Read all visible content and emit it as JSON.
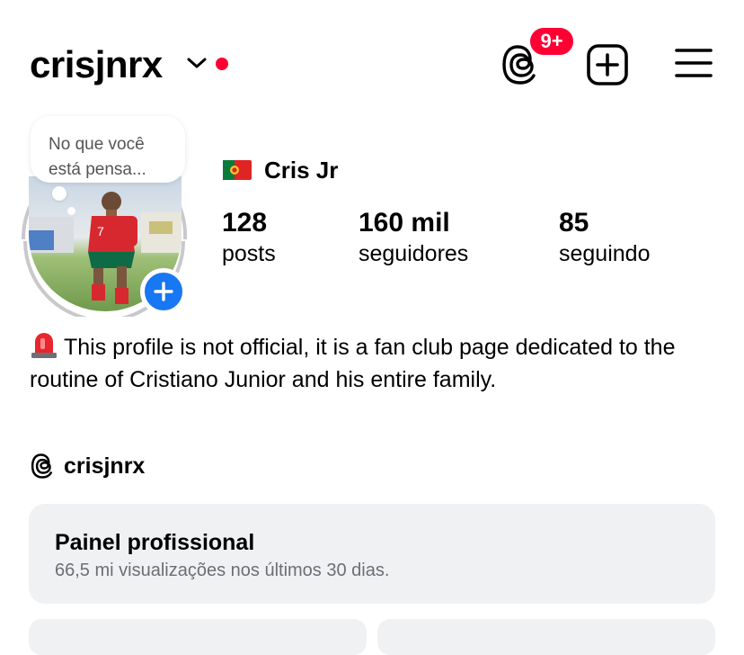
{
  "header": {
    "username": "crisjnrx",
    "notification_badge": "9+"
  },
  "note": {
    "text": "No que você está pensa..."
  },
  "profile": {
    "display_name": "Cris Jr",
    "stats": [
      {
        "value": "128",
        "label": "posts"
      },
      {
        "value": "160 mil",
        "label": "seguidores"
      },
      {
        "value": "85",
        "label": "seguindo"
      }
    ],
    "bio": "This profile is not official, it is a fan club page dedicated to the routine of Cristiano Junior and his entire family.",
    "threads_handle": "crisjnrx"
  },
  "panel": {
    "title": "Painel profissional",
    "subtitle": "66,5 mi visualizações nos últimos 30 dias."
  },
  "colors": {
    "accent_red": "#ff0033",
    "add_blue": "#1877f2",
    "panel_bg": "#f0f1f3"
  },
  "icons": [
    "chevron-down-icon",
    "threads-icon",
    "new-post-icon",
    "menu-icon",
    "portugal-flag-icon",
    "siren-icon",
    "plus-icon"
  ]
}
